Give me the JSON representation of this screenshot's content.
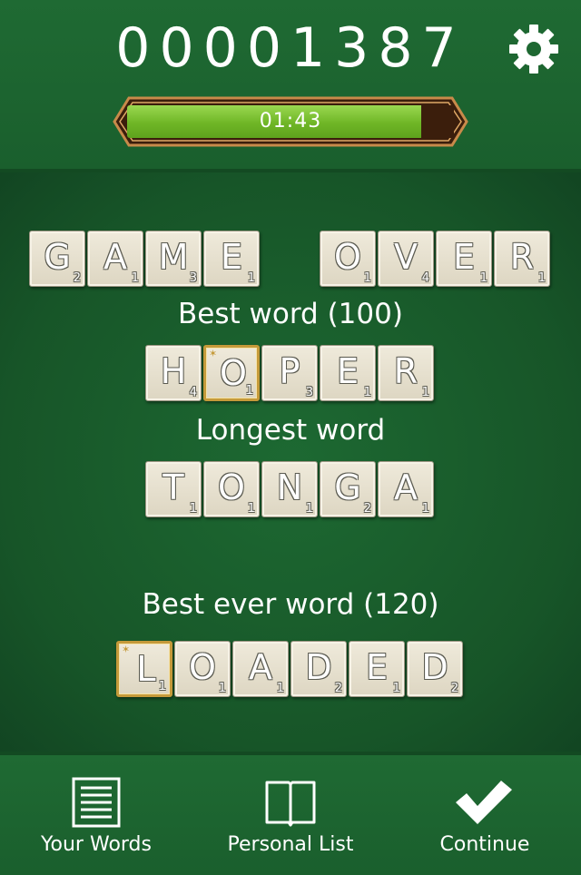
{
  "header": {
    "score": "00001387",
    "timer_text": "01:43",
    "timer_fraction": 0.9
  },
  "board": {
    "title_words": [
      [
        {
          "l": "G",
          "p": "2"
        },
        {
          "l": "A",
          "p": "1"
        },
        {
          "l": "M",
          "p": "3"
        },
        {
          "l": "E",
          "p": "1"
        }
      ],
      [
        {
          "l": "O",
          "p": "1"
        },
        {
          "l": "V",
          "p": "4"
        },
        {
          "l": "E",
          "p": "1"
        },
        {
          "l": "R",
          "p": "1"
        }
      ]
    ],
    "best_word_label": "Best word (100)",
    "best_word": [
      {
        "l": "H",
        "p": "4"
      },
      {
        "l": "O",
        "p": "1",
        "bonus": true
      },
      {
        "l": "P",
        "p": "3"
      },
      {
        "l": "E",
        "p": "1"
      },
      {
        "l": "R",
        "p": "1"
      }
    ],
    "longest_word_label": "Longest word",
    "longest_word": [
      {
        "l": "T",
        "p": "1"
      },
      {
        "l": "O",
        "p": "1"
      },
      {
        "l": "N",
        "p": "1"
      },
      {
        "l": "G",
        "p": "2"
      },
      {
        "l": "A",
        "p": "1"
      }
    ],
    "best_ever_label": "Best ever word (120)",
    "best_ever_word": [
      {
        "l": "L",
        "p": "1",
        "bonus": true
      },
      {
        "l": "O",
        "p": "1"
      },
      {
        "l": "A",
        "p": "1"
      },
      {
        "l": "D",
        "p": "2"
      },
      {
        "l": "E",
        "p": "1"
      },
      {
        "l": "D",
        "p": "2"
      }
    ]
  },
  "footer": {
    "your_words": "Your Words",
    "personal_list": "Personal List",
    "continue": "Continue"
  },
  "icons": {
    "settings": "gear-icon",
    "your_words": "list-document-icon",
    "personal_list": "open-book-icon",
    "continue": "checkmark-icon"
  },
  "colors": {
    "felt_green": "#1a5f2d",
    "timer_green": "#6fb626",
    "timer_frame": "#c88a4a",
    "tile": "#e8e2d0",
    "bonus_border": "#c59a3a"
  }
}
